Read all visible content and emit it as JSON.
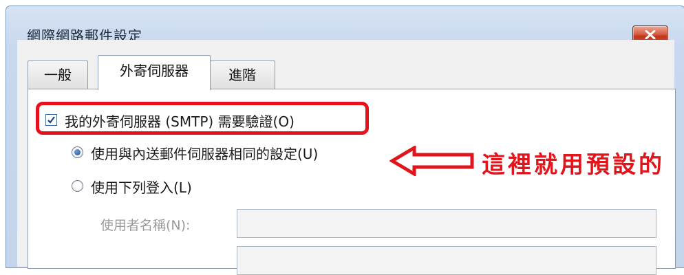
{
  "window": {
    "title": "網際網路郵件設定"
  },
  "tabs": [
    {
      "label": "一般",
      "active": false
    },
    {
      "label": "外寄伺服器",
      "active": true
    },
    {
      "label": "進階",
      "active": false
    }
  ],
  "outgoing": {
    "auth_checkbox_label": "我的外寄伺服器 (SMTP) 需要驗證(O)",
    "auth_checked": true,
    "radio_same_label": "使用與內送郵件伺服器相同的設定(U)",
    "radio_same_selected": true,
    "radio_login_label": "使用下列登入(L)",
    "username_label": "使用者名稱(N):",
    "username_value": "",
    "password_value": ""
  },
  "annotation": {
    "text": "這裡就用預設的",
    "color": "#e0161c"
  },
  "colors": {
    "accent_highlight": "#e8101a",
    "close_button": "#c23518"
  }
}
